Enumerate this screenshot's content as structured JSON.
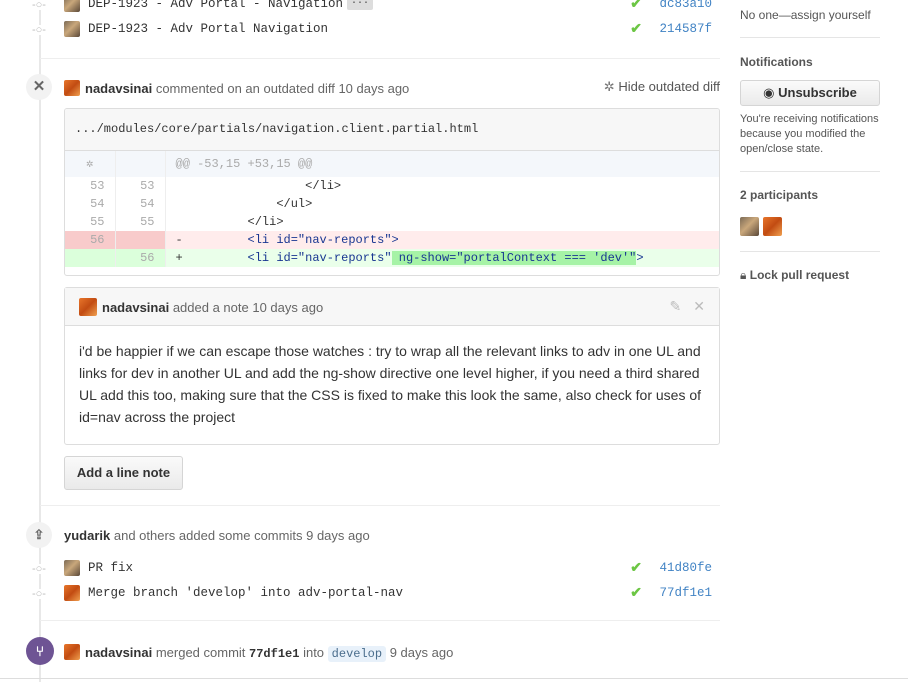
{
  "commits_top": [
    {
      "message": "DEP-1923 - Adv Portal - Navigation",
      "sha": "dc83a10",
      "has_ellipsis": true
    },
    {
      "message": "DEP-1923 - Adv Portal Navigation",
      "sha": "214587f"
    }
  ],
  "ellipsis_label": "···",
  "comment_event": {
    "author": "nadavsinai",
    "action": "commented on an outdated diff",
    "time": "10 days ago",
    "hide_diff_label": "Hide outdated diff"
  },
  "diff": {
    "file_path": ".../modules/core/partials/navigation.client.partial.html",
    "hunk": "@@ -53,15 +53,15 @@",
    "lines": [
      {
        "old": "53",
        "new": "53",
        "sign": "",
        "code": "                </li>",
        "type": "ctx"
      },
      {
        "old": "54",
        "new": "54",
        "sign": "",
        "code": "            </ul>",
        "type": "ctx"
      },
      {
        "old": "55",
        "new": "55",
        "sign": "",
        "code": "        </li>",
        "type": "ctx"
      },
      {
        "old": "56",
        "new": "",
        "sign": "-",
        "code": "        <li id=\"nav-reports\">",
        "type": "del"
      },
      {
        "old": "",
        "new": "56",
        "sign": "+",
        "code": "        <li id=\"nav-reports\"",
        "highlight": " ng-show=\"portalContext === 'dev'\"",
        "tail": ">",
        "type": "add"
      }
    ]
  },
  "note": {
    "author": "nadavsinai",
    "action": "added a note",
    "time": "10 days ago",
    "body": "i'd be happier if we can escape those watches : try to wrap all the relevant links to adv in one UL and links for dev in another UL and add the ng-show directive one level higher, if you need a third shared UL add this too, making sure that the CSS is fixed to make this look the same, also check for uses of id=nav across the project"
  },
  "add_line_note_label": "Add a line note",
  "commits_event": {
    "author": "yudarik",
    "action": "and others added some commits",
    "time": "9 days ago"
  },
  "commits_bottom": [
    {
      "message": "PR fix",
      "sha": "41d80fe"
    },
    {
      "message": "Merge branch 'develop' into adv-portal-nav",
      "sha": "77df1e1"
    }
  ],
  "merge_event": {
    "author": "nadavsinai",
    "action": "merged commit",
    "commit": "77df1e1",
    "into": "into",
    "branch": "develop",
    "time": "9 days ago"
  },
  "sidebar": {
    "assignee_text": "No one—assign yourself",
    "notifications_title": "Notifications",
    "unsubscribe_label": "Unsubscribe",
    "notifications_reason": "You're receiving notifications because you modified the open/close state.",
    "participants_title": "2 participants",
    "lock_label": "Lock pull request"
  },
  "colors": {
    "link": "#4183c4",
    "check": "#6cc644",
    "merge_purple": "#6e5494"
  }
}
